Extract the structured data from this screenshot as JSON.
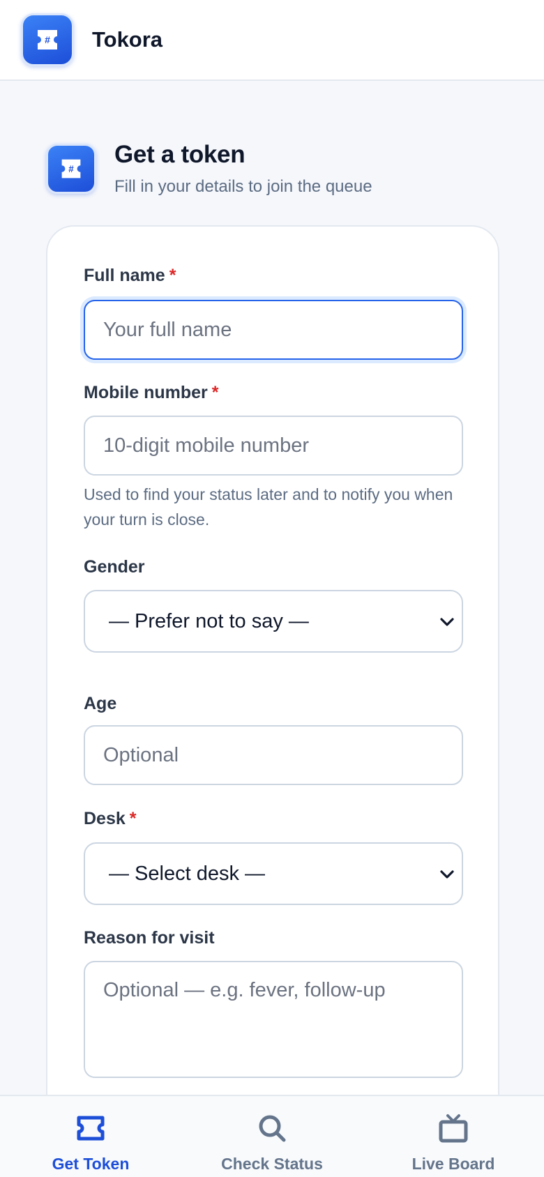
{
  "app": {
    "name": "Tokora"
  },
  "header": {
    "title": "Get a token",
    "subtitle": "Fill in your details to join the queue"
  },
  "form": {
    "full_name": {
      "label": "Full name",
      "required_mark": "*",
      "placeholder": "Your full name",
      "value": ""
    },
    "mobile": {
      "label": "Mobile number",
      "required_mark": "*",
      "placeholder": "10-digit mobile number",
      "value": "",
      "help": "Used to find your status later and to notify you when your turn is close."
    },
    "gender": {
      "label": "Gender",
      "selected": "— Prefer not to say —"
    },
    "age": {
      "label": "Age",
      "placeholder": "Optional",
      "value": ""
    },
    "desk": {
      "label": "Desk",
      "required_mark": "*",
      "selected": "— Select desk —"
    },
    "reason": {
      "label": "Reason for visit",
      "placeholder": "Optional — e.g. fever, follow-up",
      "value": ""
    }
  },
  "nav": {
    "items": [
      {
        "label": "Get Token",
        "icon": "ticket-icon",
        "active": true
      },
      {
        "label": "Check Status",
        "icon": "search-icon",
        "active": false
      },
      {
        "label": "Live Board",
        "icon": "tv-icon",
        "active": false
      }
    ]
  },
  "colors": {
    "accent": "#1d4ed8",
    "required": "#dc2626",
    "muted": "#64748b"
  }
}
